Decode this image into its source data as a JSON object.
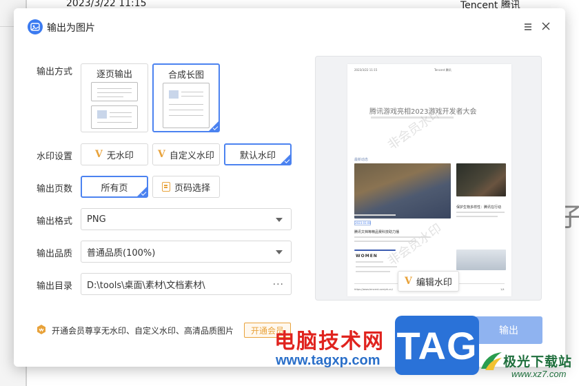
{
  "background": {
    "date_text": "2023/3/22 11:15",
    "brand_text": "Tencent 腾讯",
    "right_fragment": "子"
  },
  "dialog": {
    "title": "输出为图片",
    "icon": "image-icon"
  },
  "labels": {
    "output_mode": "输出方式",
    "watermark": "水印设置",
    "pages": "输出页数",
    "format": "输出格式",
    "quality": "输出品质",
    "directory": "输出目录"
  },
  "modes": [
    {
      "label": "逐页输出",
      "selected": false
    },
    {
      "label": "合成长图",
      "selected": true
    }
  ],
  "watermark_options": [
    {
      "label": "无水印",
      "selected": false
    },
    {
      "label": "自定义水印",
      "selected": false
    },
    {
      "label": "默认水印",
      "selected": true
    }
  ],
  "page_options": [
    {
      "label": "所有页",
      "selected": true
    },
    {
      "label": "页码选择",
      "selected": false
    }
  ],
  "format": {
    "value": "PNG"
  },
  "quality": {
    "value": "普通品质(100%)"
  },
  "directory": {
    "value": "D:\\tools\\桌面\\素材\\文档素材\\",
    "more": "···"
  },
  "preview": {
    "header_date": "2023/3/22 11:15",
    "header_brand": "Tencent 腾讯",
    "title": "腾讯游戏亮相2023游戏开发者大会",
    "watermark_text": "非会员水印",
    "section": "最新动态",
    "tag": "2023.03.08",
    "headline_1": "腾讯文档等精品赛科技助力播",
    "headline_2": "保护生物多样性：腾讯在行动",
    "women": "WOMEN",
    "footer_url": "https://www.tencent.com/zh-cn/",
    "footer_page": "1/4",
    "edit_watermark": "编辑水印"
  },
  "footer": {
    "vip_text": "开通会员尊享无水印、自定义水印、高清品质图片",
    "vip_button": "开通会员",
    "export_button": "输出"
  },
  "overlay": {
    "site_cn": "电脑技术网",
    "site_url": "www.tagxp.com",
    "tag": "TAG",
    "logo_text": "极光下载站",
    "logo_url": "www.xz7.com"
  },
  "colors": {
    "accent": "#4b82f0",
    "vip": "#e8a23a",
    "export": "#8fb3f0"
  }
}
